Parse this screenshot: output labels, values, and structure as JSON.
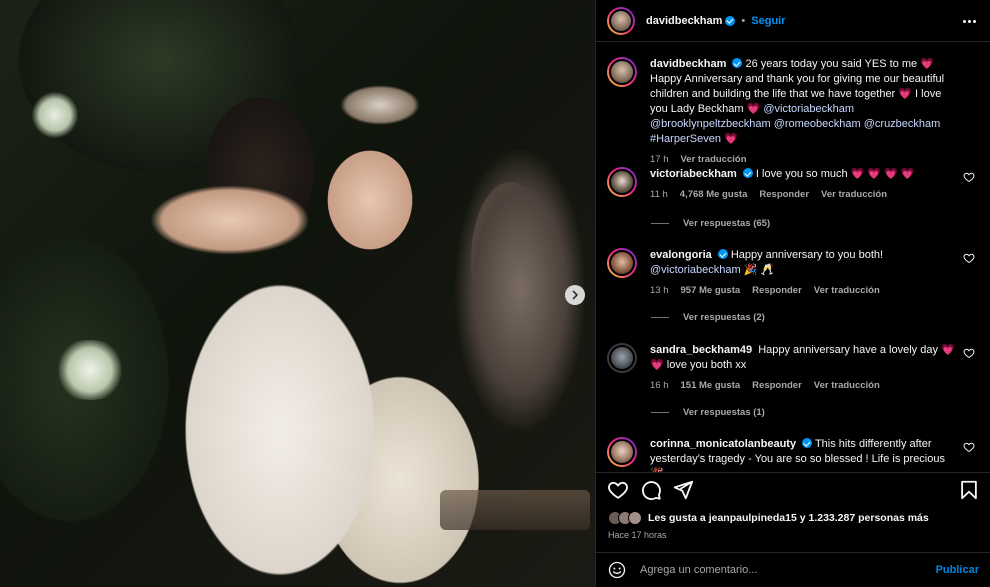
{
  "post": {
    "author": "davidbeckham",
    "follow_label": "Seguir",
    "caption_parts": {
      "text1": "26 years today you said YES to me 💗 Happy Anniversary and thank you for giving me our beautiful children and building the life that we have together 💗 I love you Lady Beckham 💗 ",
      "mention1": "@victoriabeckham",
      "mention2": "@brooklynpeltzbeckham",
      "mention3": "@romeobeckham",
      "mention4": "@cruzbeckham",
      "hashtag": "#HarperSeven",
      "end": " 💗"
    },
    "caption_time": "17 h",
    "caption_translate": "Ver traducción"
  },
  "comments": [
    {
      "username": "victoriabeckham",
      "verified": true,
      "text": "I love you so much 💗 💗 💗 💗",
      "time": "11 h",
      "likes": "4,768 Me gusta",
      "reply": "Responder",
      "translate": "Ver traducción",
      "replies": "Ver respuestas (65)"
    },
    {
      "username": "evalongoria",
      "verified": true,
      "text": "Happy anniversary to you both!",
      "mention": "@victoriabeckham",
      "text_end": " 🎉 🥂",
      "time": "13 h",
      "likes": "957 Me gusta",
      "reply": "Responder",
      "translate": "Ver traducción",
      "replies": "Ver respuestas (2)"
    },
    {
      "username": "sandra_beckham49",
      "verified": false,
      "text": "Happy anniversary have a lovely day 💗 💗 love you both xx",
      "time": "16 h",
      "likes": "151 Me gusta",
      "reply": "Responder",
      "translate": "Ver traducción",
      "replies": "Ver respuestas (1)"
    },
    {
      "username": "corinna_monicatolanbeauty",
      "verified": true,
      "text": "This hits differently after yesterday's tragedy - You are so so blessed ! Life is precious 🎉"
    }
  ],
  "likes_text": "Les gusta a jeanpaulpineda15 y 1.233.287 personas más",
  "timestamp": "Hace 17 horas",
  "comment_placeholder": "Agrega un comentario...",
  "publish_label": "Publicar",
  "icons": {
    "like": "heart-outline-icon",
    "comment": "comment-bubble-icon",
    "share": "paper-plane-icon",
    "save": "bookmark-icon",
    "emoji": "smiley-icon",
    "next": "chevron-right-icon"
  },
  "colors": {
    "accent": "#0095f6",
    "heart_pink": "#ff3b8d",
    "background": "#000000"
  }
}
